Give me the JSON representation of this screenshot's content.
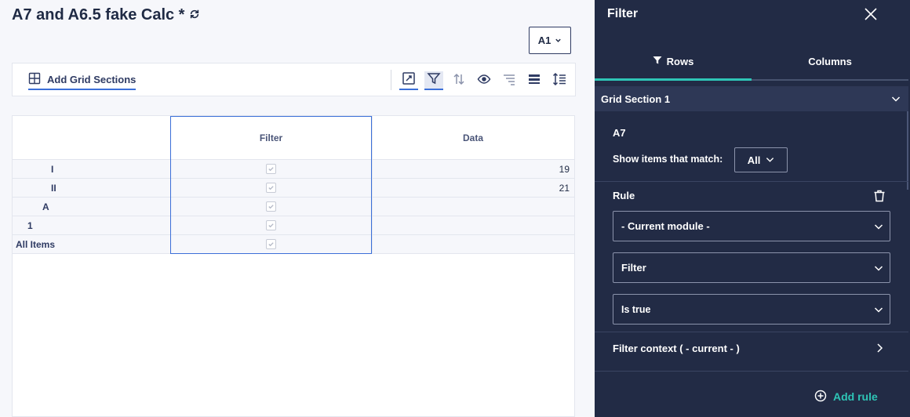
{
  "page": {
    "title": "A7 and A6.5 fake Calc *",
    "version_label": "A1"
  },
  "toolbar": {
    "add_grid_sections": "Add Grid Sections"
  },
  "grid": {
    "columns": [
      "",
      "Filter",
      "Data"
    ],
    "rows": [
      {
        "label": "I",
        "checked": true,
        "value": "19"
      },
      {
        "label": "II",
        "checked": true,
        "value": "21"
      },
      {
        "label": "A",
        "checked": true,
        "value": ""
      },
      {
        "label": "1",
        "checked": true,
        "value": ""
      },
      {
        "label": "All Items",
        "checked": true,
        "value": ""
      }
    ]
  },
  "filter_panel": {
    "title": "Filter",
    "tabs": [
      {
        "label": "Rows",
        "active": true
      },
      {
        "label": "Columns",
        "active": false
      }
    ],
    "section": "Grid Section 1",
    "dimension": "A7",
    "match_label": "Show items that match:",
    "match_value": "All",
    "rule_label": "Rule",
    "rule_module": "- Current module -",
    "rule_line_item": "Filter",
    "rule_condition": "Is true",
    "filter_context": "Filter context ( - current - )",
    "add_rule": "Add rule"
  },
  "colors": {
    "panel_bg": "#222b45",
    "accent_teal": "#2ec5b6",
    "accent_blue": "#3b6fd8"
  }
}
